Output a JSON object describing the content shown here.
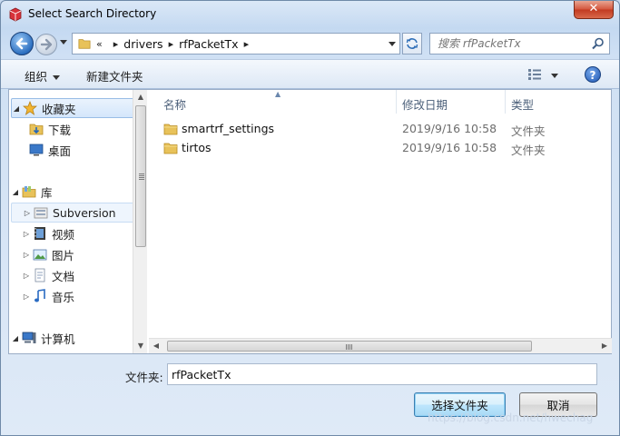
{
  "window": {
    "title": "Select Search Directory",
    "close_label": "✕"
  },
  "address_bar": {
    "overflow": "«",
    "crumbs": [
      "drivers",
      "rfPacketTx"
    ],
    "separator": "▸"
  },
  "search": {
    "placeholder": "搜索 rfPacketTx"
  },
  "toolbar": {
    "organize_label": "组织",
    "new_folder_label": "新建文件夹",
    "help_label": "?"
  },
  "sidebar": {
    "favorites_label": "收藏夹",
    "favorites": [
      {
        "label": "下载",
        "icon": "download-folder-icon"
      },
      {
        "label": "桌面",
        "icon": "desktop-icon"
      }
    ],
    "libraries_label": "库",
    "libraries": [
      {
        "label": "Subversion",
        "icon": "subversion-library-icon"
      },
      {
        "label": "视频",
        "icon": "videos-library-icon"
      },
      {
        "label": "图片",
        "icon": "pictures-library-icon"
      },
      {
        "label": "文档",
        "icon": "documents-library-icon"
      },
      {
        "label": "音乐",
        "icon": "music-library-icon"
      }
    ],
    "computer_label": "计算机"
  },
  "file_list": {
    "columns": {
      "name": "名称",
      "date": "修改日期",
      "type": "类型"
    },
    "rows": [
      {
        "name": "smartrf_settings",
        "date": "2019/9/16 10:58",
        "type": "文件夹"
      },
      {
        "name": "tirtos",
        "date": "2019/9/16 10:58",
        "type": "文件夹"
      }
    ]
  },
  "footer": {
    "folder_label": "文件夹:",
    "folder_value": "rfPacketTx",
    "select_button": "选择文件夹",
    "cancel_button": "取消"
  },
  "watermark": "https://blog.csdn.net/hwechag",
  "colors": {
    "title_bar": "#c4d9f1",
    "close_button": "#c13a20",
    "folder": "#e8c25a",
    "accent": "#2c6fc0"
  }
}
